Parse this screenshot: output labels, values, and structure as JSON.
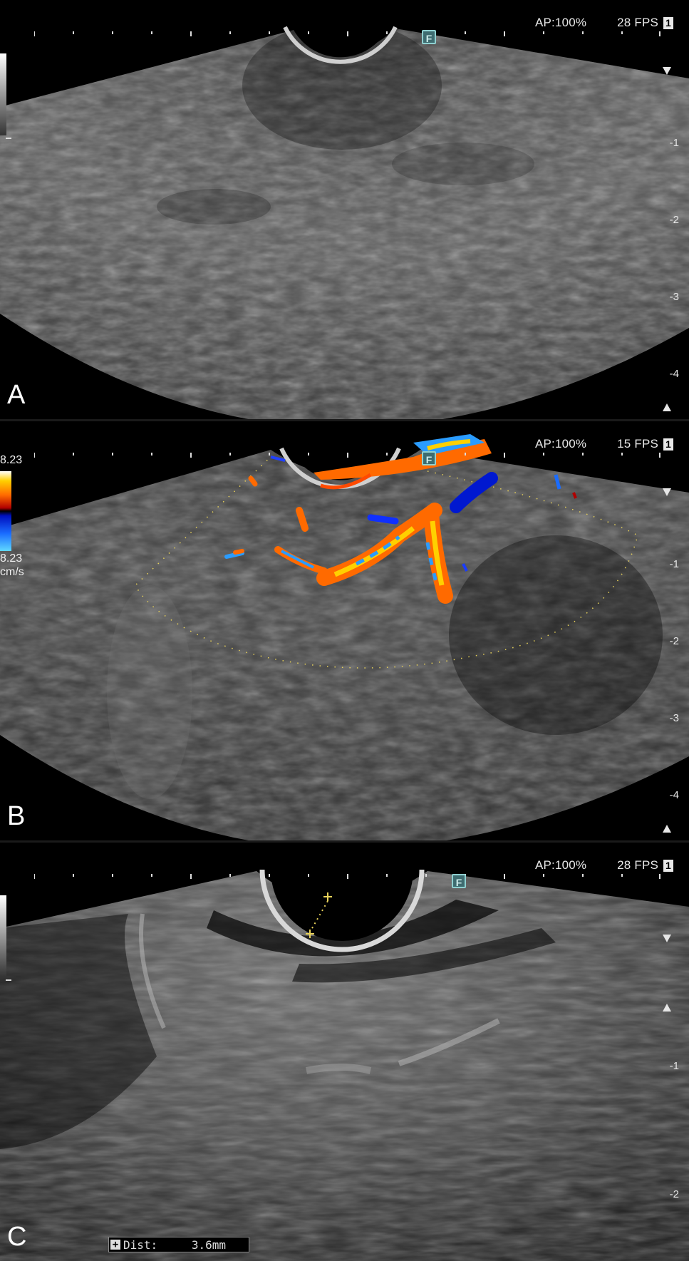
{
  "panels": [
    {
      "letter": "A",
      "ap": "AP:100%",
      "fps": "28 FPS",
      "probe": "1",
      "focus_marker": "F",
      "depth_labels": [
        "-1",
        "-2",
        "-3",
        "-4"
      ]
    },
    {
      "letter": "B",
      "ap": "AP:100%",
      "fps": "15 FPS",
      "probe": "1",
      "focus_marker": "F",
      "depth_labels": [
        "-1",
        "-2",
        "-3",
        "-4"
      ],
      "color_scale": {
        "top_value": "8.23",
        "bottom_value": "8.23",
        "unit": "cm/s",
        "colors": [
          "#ffffff",
          "#ffd000",
          "#ff6a00",
          "#b00000",
          "#000000",
          "#0010c0",
          "#1a6cff",
          "#60d8ff"
        ]
      }
    },
    {
      "letter": "C",
      "ap": "AP:100%",
      "fps": "28 FPS",
      "probe": "1",
      "focus_marker": "F",
      "depth_labels": [
        "-1",
        "-2"
      ],
      "measurement": {
        "label": "Dist:",
        "value": "3.6mm"
      }
    }
  ],
  "colors": {
    "background": "#000000",
    "text": "#e6e6e6",
    "caliper": "#e8d25a",
    "focus_marker_bg": "#3e6c70"
  }
}
